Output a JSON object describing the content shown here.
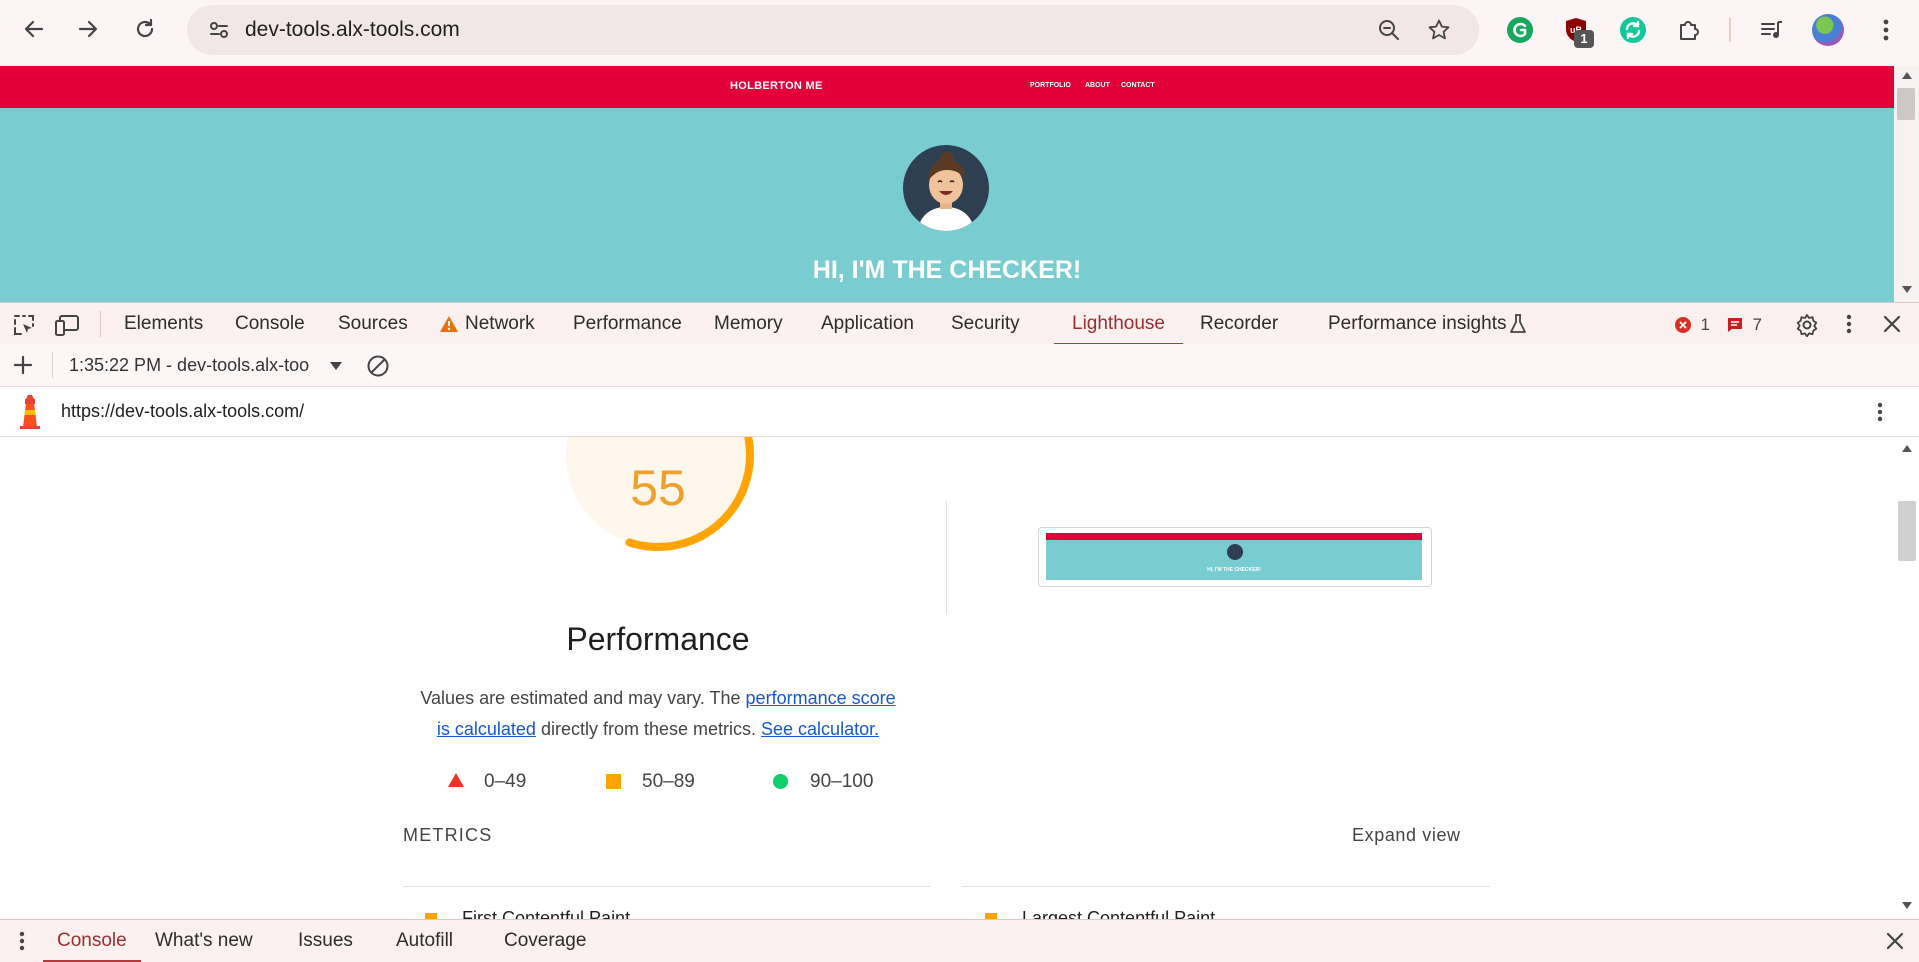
{
  "browser": {
    "url": "dev-tools.alx-tools.com",
    "ublock_badge": "1"
  },
  "site": {
    "brand": "HOLBERTON ME",
    "nav": [
      "PORTFOLIO",
      "ABOUT",
      "CONTACT"
    ],
    "hero_title": "HI, I'M THE CHECKER!"
  },
  "devtools": {
    "tabs": [
      "Elements",
      "Console",
      "Sources",
      "Network",
      "Performance",
      "Memory",
      "Application",
      "Security",
      "Lighthouse",
      "Recorder",
      "Performance insights"
    ],
    "active_tab": "Lighthouse",
    "error_count": "1",
    "message_count": "7"
  },
  "lighthouse": {
    "report_select": "1:35:22 PM - dev-tools.alx-too",
    "report_url": "https://dev-tools.alx-tools.com/",
    "score": "55",
    "score_fraction": 0.55,
    "category_title": "Performance",
    "desc_prefix": "Values are estimated and may vary. The ",
    "desc_link1_line1": "performance score",
    "desc_link1_line2": "is calculated",
    "desc_middle": " directly from these metrics. ",
    "desc_link2": "See calculator.",
    "legend": [
      {
        "range": "0–49",
        "shape": "triangle",
        "color": "#eb3323"
      },
      {
        "range": "50–89",
        "shape": "square",
        "color": "#ffa400"
      },
      {
        "range": "90–100",
        "shape": "circle",
        "color": "#0cce6b"
      }
    ],
    "metrics_heading": "METRICS",
    "expand_label": "Expand view",
    "metric_partial_left": "First Contentful Paint",
    "metric_partial_right": "Largest Contentful Paint",
    "thumb_title": "HI, I'M THE CHECKER!"
  },
  "drawer": {
    "tabs": [
      "Console",
      "What's new",
      "Issues",
      "Autofill",
      "Coverage"
    ],
    "active_tab": "Console"
  },
  "colors": {
    "site_nav": "#e1003a",
    "hero_bg": "#79cdd1",
    "score_orange": "#ffa400",
    "score_text": "#f0a12c",
    "gauge_bg": "#fff7eb"
  }
}
